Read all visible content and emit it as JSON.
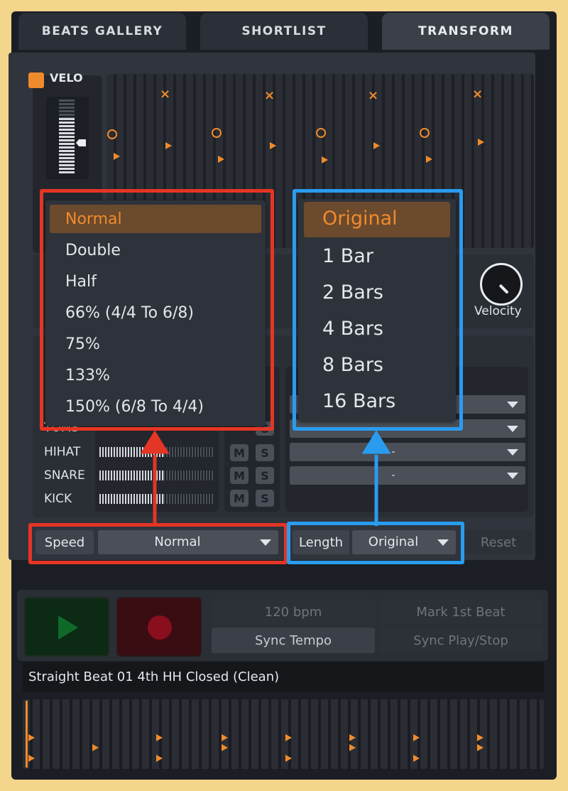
{
  "tabs": [
    "BEATS GALLERY",
    "SHORTLIST",
    "TRANSFORM"
  ],
  "velo_label": "VELO",
  "velocity_label": "Velocity",
  "speed_menu": {
    "options": [
      "Normal",
      "Double",
      "Half",
      "66% (4/4 To 6/8)",
      "75%",
      "133%",
      "150% (6/8 To 4/4)"
    ],
    "selected": "Normal"
  },
  "length_menu": {
    "options": [
      "Original",
      "1 Bar",
      "2 Bars",
      "4 Bars",
      "8 Bars",
      "16 Bars"
    ],
    "selected": "Original"
  },
  "instruments": [
    {
      "label": "TOMS",
      "mute": "M",
      "solo": "S"
    },
    {
      "label": "HIHAT",
      "mute": "M",
      "solo": "S"
    },
    {
      "label": "SNARE",
      "mute": "M",
      "solo": "S"
    },
    {
      "label": "KICK",
      "mute": "M",
      "solo": "S"
    }
  ],
  "kit_selects": [
    "-",
    "-"
  ],
  "controls": {
    "speed_label": "Speed",
    "speed_value": "Normal",
    "length_label": "Length",
    "length_value": "Original",
    "reset_label": "Reset"
  },
  "transport": {
    "bpm": "120 bpm",
    "mark_first_beat": "Mark 1st Beat",
    "sync_tempo": "Sync Tempo",
    "sync_play_stop": "Sync Play/Stop"
  },
  "status_text": "Straight Beat 01 4th HH Closed (Clean)",
  "colors": {
    "accent": "#f08b2c",
    "annotation_red": "#e53525",
    "annotation_blue": "#2a9cf0",
    "background": "#f4d58c"
  }
}
